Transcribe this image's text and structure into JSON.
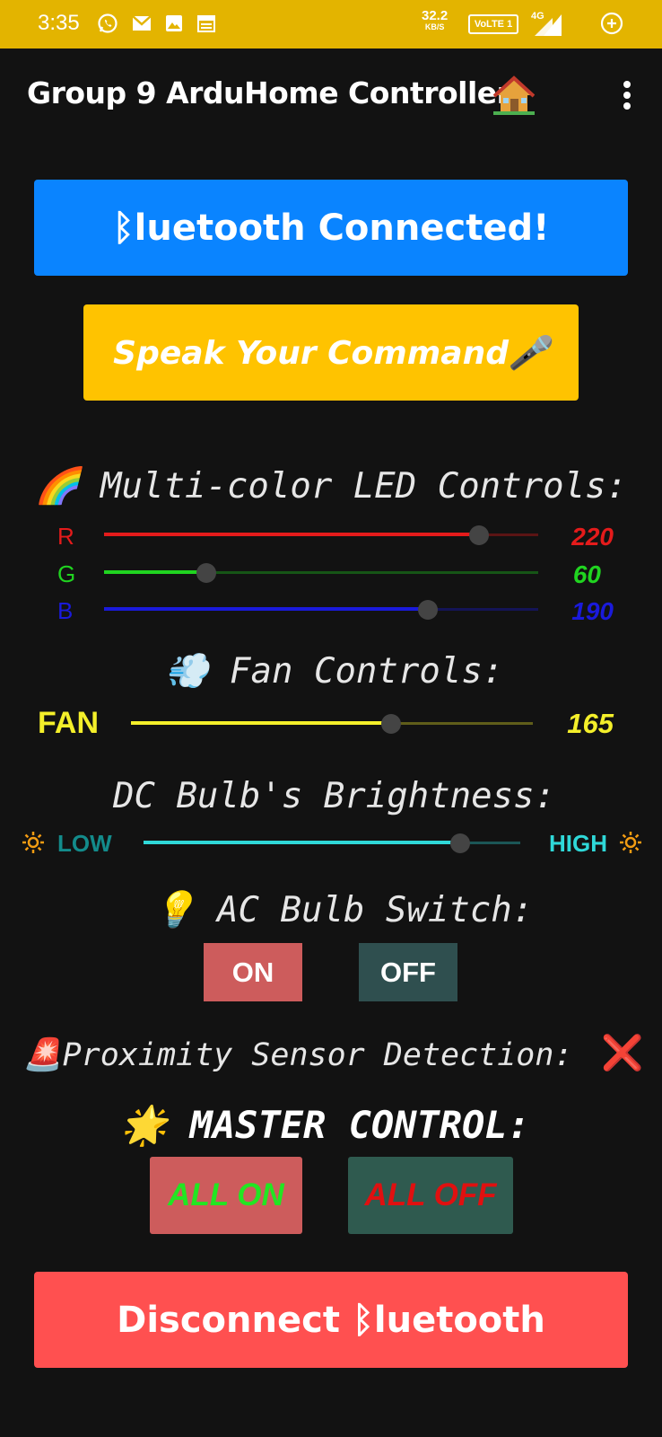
{
  "status_bar": {
    "time": "3:35",
    "net_speed": "32.2",
    "net_unit": "KB/S",
    "volte": "VoLTE 1",
    "network": "4G",
    "icons": [
      "whatsapp-icon",
      "mail-icon",
      "gallery-icon",
      "calendar-icon",
      "signal-icon",
      "battery-saver-icon"
    ]
  },
  "app_bar": {
    "title": "Group 9 ArduHome Controller",
    "icons": [
      "house-icon",
      "overflow-menu-icon"
    ]
  },
  "buttons": {
    "bluetooth": "ᛒluetooth Connected!",
    "speak": "Speak Your Command🎤",
    "disconnect": "Disconnect ᛒluetooth"
  },
  "led": {
    "heading": "🌈 Multi-color LED Controls:",
    "channels": [
      {
        "label": "R",
        "value": "220",
        "fraction": 0.863,
        "color": "#e41b1b"
      },
      {
        "label": "G",
        "value": "60",
        "fraction": 0.235,
        "color": "#20d420"
      },
      {
        "label": "B",
        "value": "190",
        "fraction": 0.745,
        "color": "#1a1adb"
      }
    ]
  },
  "fan": {
    "heading": "💨 Fan Controls:",
    "label": "FAN",
    "value": "165",
    "fraction": 0.647,
    "color": "#f4ef2a"
  },
  "dc_bulb": {
    "heading": "DC Bulb's Brightness:",
    "low_label": "LOW",
    "high_label": "HIGH",
    "fraction": 0.84,
    "color": "#2fd8d8"
  },
  "ac_bulb": {
    "heading": "💡 AC Bulb Switch:",
    "on_label": "ON",
    "off_label": "OFF"
  },
  "proximity": {
    "heading": "🚨Proximity Sensor Detection:",
    "status": "❌"
  },
  "master": {
    "heading": "🌟 MASTER CONTROL:",
    "all_on_label": "ALL ON",
    "all_off_label": "ALL OFF"
  },
  "colors": {
    "status_bar": "#e3b400",
    "background": "#121212",
    "bluetooth_button": "#0a84ff",
    "speak_button": "#ffc300",
    "disconnect_button": "#ff5050",
    "on_button": "#cd5c5c",
    "off_button": "#2f4f4f"
  }
}
